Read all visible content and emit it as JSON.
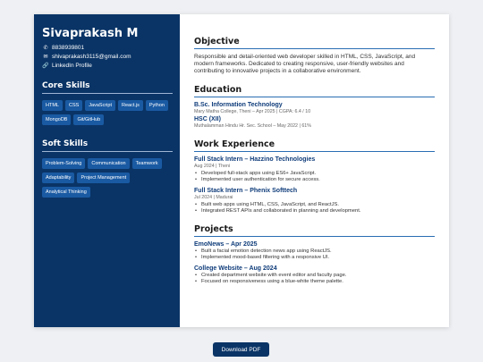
{
  "sidebar": {
    "name": "Sivaprakash M",
    "phone": "8838939801",
    "email": "shivaprakash3115@gmail.com",
    "linkedin": "LinkedIn Profile",
    "core_skills_heading": "Core Skills",
    "core_skills": [
      "HTML",
      "CSS",
      "JavaScript",
      "React.js",
      "Python",
      "MongoDB",
      "Git/GitHub"
    ],
    "soft_skills_heading": "Soft Skills",
    "soft_skills": [
      "Problem-Solving",
      "Communication",
      "Teamwork",
      "Adaptability",
      "Project Management",
      "Analytical Thinking"
    ]
  },
  "main": {
    "objective": {
      "heading": "Objective",
      "text": "Responsible and detail-oriented web developer skilled in HTML, CSS, JavaScript, and modern frameworks. Dedicated to creating responsive, user-friendly websites and contributing to innovative projects in a collaborative environment."
    },
    "education": {
      "heading": "Education",
      "items": [
        {
          "title": "B.Sc. Information Technology",
          "sub": "Mary Matha College, Theni – Apr 2025 | CGPA: 6.4 / 10"
        },
        {
          "title": "HSC (XII)",
          "sub": "Muthalamman Hindu Hr. Sec. School – May 2022 | 61%"
        }
      ]
    },
    "experience": {
      "heading": "Work Experience",
      "items": [
        {
          "title": "Full Stack Intern – Hazzino Technologies",
          "sub": "Aug 2024 | Theni",
          "bullets": [
            "Developed full-stack apps using ES6+ JavaScript.",
            "Implemented user authentication for secure access."
          ]
        },
        {
          "title": "Full Stack Intern – Phenix Softtech",
          "sub": "Jul 2024 | Madurai",
          "bullets": [
            "Built web apps using HTML, CSS, JavaScript, and ReactJS.",
            "Integrated REST APIs and collaborated in planning and development."
          ]
        }
      ]
    },
    "projects": {
      "heading": "Projects",
      "items": [
        {
          "title": "EmoNews – Apr 2025",
          "bullets": [
            "Built a facial emotion detection news app using ReactJS.",
            "Implemented mood-based filtering with a responsive UI."
          ]
        },
        {
          "title": "College Website – Aug 2024",
          "bullets": [
            "Created department website with event editor and faculty page.",
            "Focused on responsiveness using a blue-white theme palette."
          ]
        }
      ]
    }
  },
  "download_label": "Download PDF",
  "colors": {
    "sidebar_bg": "#0a3466",
    "chip_bg": "#1a5aa3",
    "accent": "#2a6db3",
    "title": "#0f3c7a"
  }
}
